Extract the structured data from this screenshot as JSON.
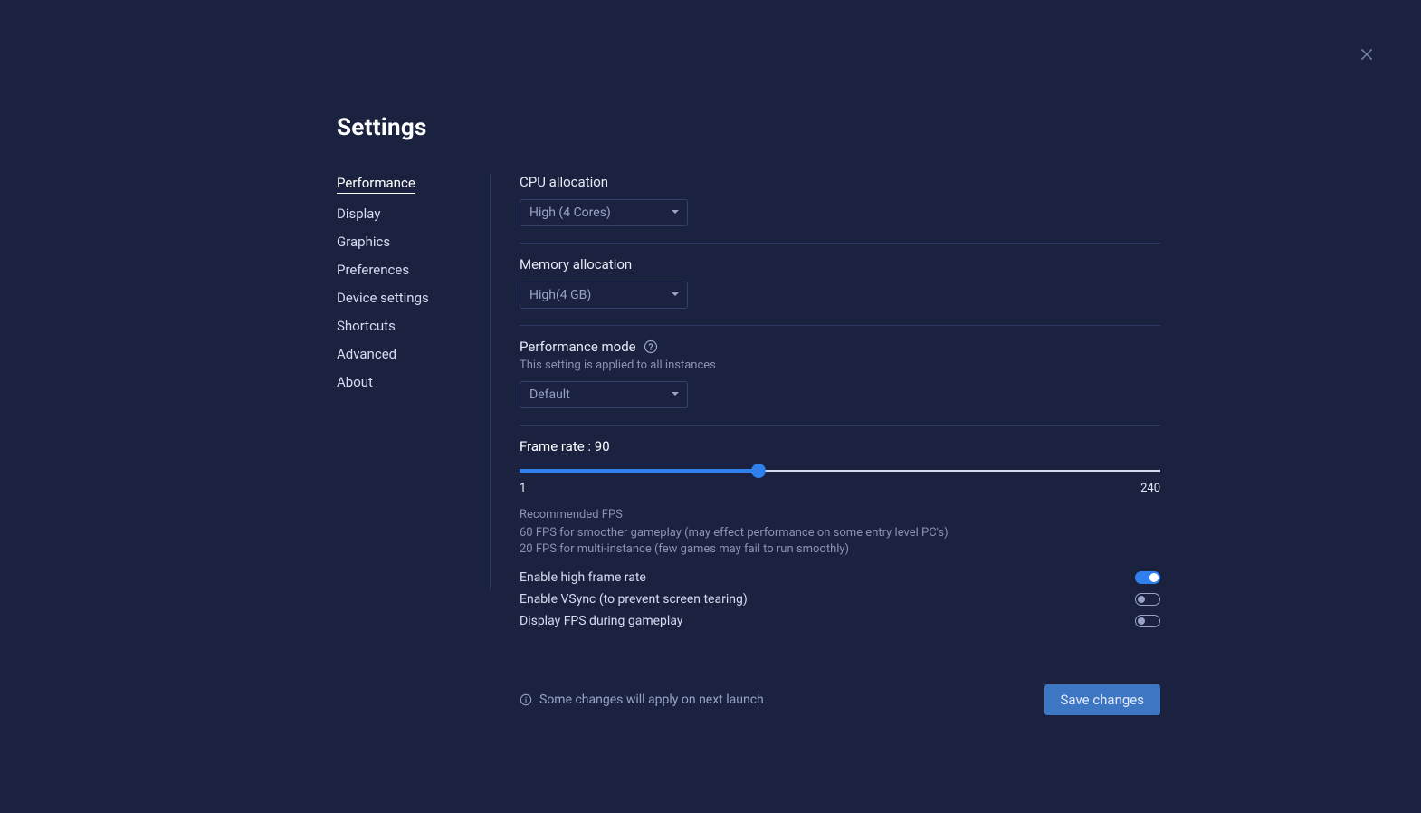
{
  "title": "Settings",
  "sidebar": {
    "items": [
      {
        "label": "Performance",
        "active": true
      },
      {
        "label": "Display"
      },
      {
        "label": "Graphics"
      },
      {
        "label": "Preferences"
      },
      {
        "label": "Device settings"
      },
      {
        "label": "Shortcuts"
      },
      {
        "label": "Advanced"
      },
      {
        "label": "About"
      }
    ]
  },
  "cpu": {
    "label": "CPU allocation",
    "value": "High (4 Cores)"
  },
  "memory": {
    "label": "Memory allocation",
    "value": "High(4 GB)"
  },
  "perf_mode": {
    "label": "Performance mode",
    "sub": "This setting is applied to all instances",
    "value": "Default"
  },
  "frame_rate": {
    "label": "Frame rate : 90",
    "value": 90,
    "min": 1,
    "max": 240,
    "min_label": "1",
    "max_label": "240",
    "rec_title": "Recommended FPS",
    "rec_body": "60 FPS for smoother gameplay (may effect performance on some entry level PC's) 20 FPS for multi-instance (few games may fail to run smoothly)"
  },
  "toggles": {
    "high_fps": {
      "label": "Enable high frame rate",
      "on": true
    },
    "vsync": {
      "label": "Enable VSync (to prevent screen tearing)",
      "on": false
    },
    "show_fps": {
      "label": "Display FPS during gameplay",
      "on": false
    }
  },
  "footer": {
    "note": "Some changes will apply on next launch",
    "save": "Save changes"
  }
}
